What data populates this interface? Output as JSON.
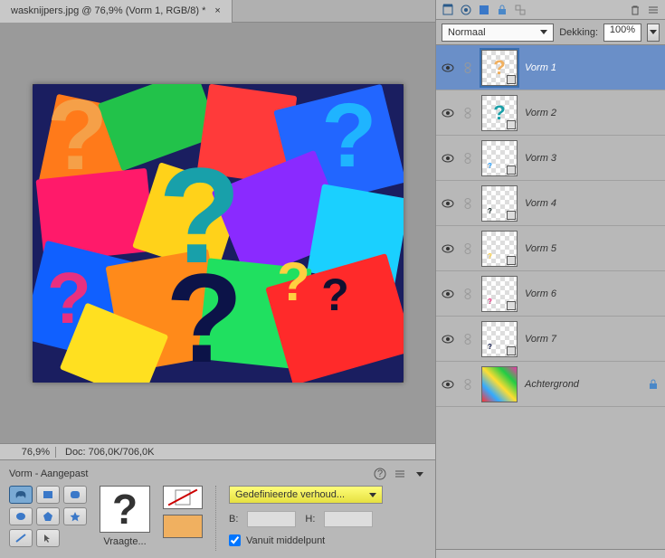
{
  "document": {
    "tab_title": "wasknijpers.jpg @ 76,9% (Vorm 1, RGB/8) *",
    "close_glyph": "×"
  },
  "status": {
    "zoom": "76,9%",
    "doc": "Doc: 706,0K/706,0K"
  },
  "tool": {
    "title": "Vorm - Aangepast",
    "preset_label": "Vraagte...",
    "ratio_label": "Gedefinieerde verhoud...",
    "width_label": "B:",
    "height_label": "H:",
    "from_center": "Vanuit middelpunt"
  },
  "blend": {
    "mode": "Normaal",
    "opacity_label": "Dekking:",
    "opacity_value": "100%"
  },
  "layers": [
    {
      "name": "Vorm 1",
      "selected": true,
      "thumb_q": true,
      "q_color": "#f0b060"
    },
    {
      "name": "Vorm 2",
      "selected": false,
      "thumb_q": true,
      "q_color": "#1aa0a8"
    },
    {
      "name": "Vorm 3",
      "selected": false,
      "thumb_q": false,
      "q_color": "#26a0ff"
    },
    {
      "name": "Vorm 4",
      "selected": false,
      "thumb_q": false,
      "q_color": "#122"
    },
    {
      "name": "Vorm 5",
      "selected": false,
      "thumb_q": false,
      "q_color": "#ffd040"
    },
    {
      "name": "Vorm 6",
      "selected": false,
      "thumb_q": false,
      "q_color": "#e83080"
    },
    {
      "name": "Vorm 7",
      "selected": false,
      "thumb_q": false,
      "q_color": "#10184a"
    },
    {
      "name": "Achtergrond",
      "selected": false,
      "bg": true
    }
  ]
}
